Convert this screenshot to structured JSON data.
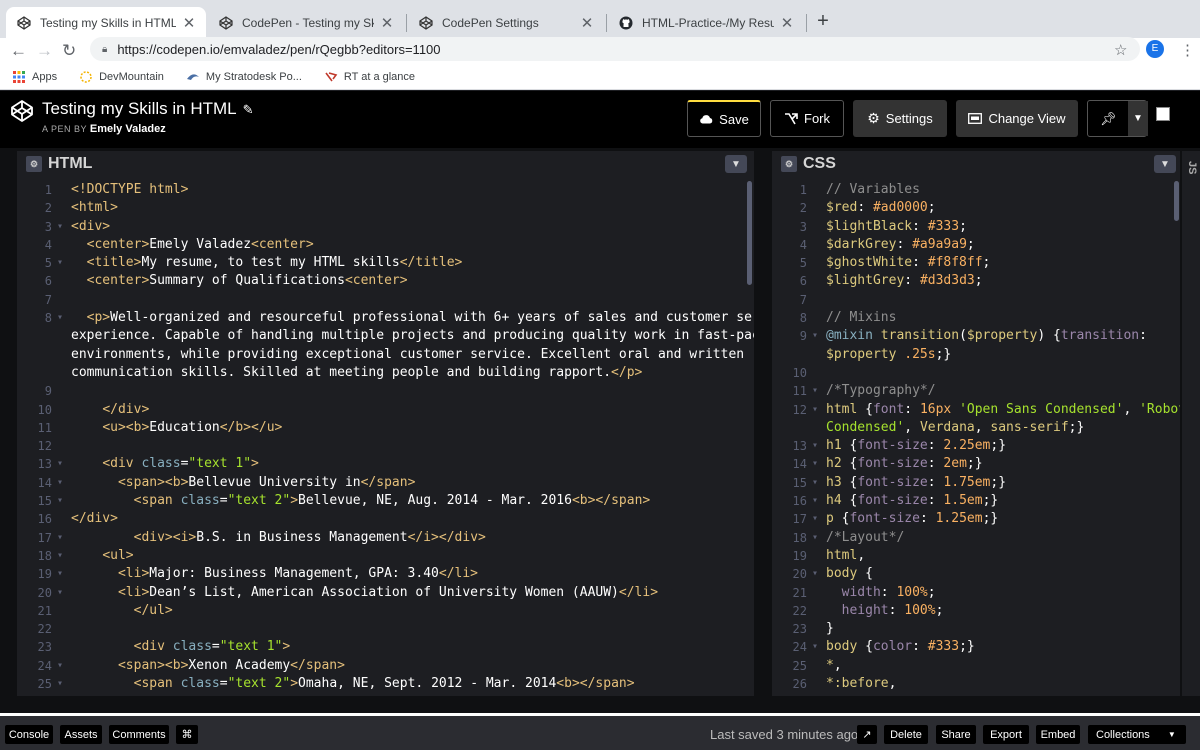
{
  "browser": {
    "tabs": [
      {
        "title": "Testing my Skills in HTML",
        "icon": "codepen-icon"
      },
      {
        "title": "CodePen - Testing my Skills in",
        "icon": "codepen-icon"
      },
      {
        "title": "CodePen Settings",
        "icon": "codepen-icon"
      },
      {
        "title": "HTML-Practice-/My Resume at",
        "icon": "github-icon"
      }
    ],
    "url": "https://codepen.io/emvaladez/pen/rQegbb?editors=1100",
    "profile_initial": "E",
    "bookmarks": [
      {
        "label": "Apps",
        "icon": "apps-grid-icon"
      },
      {
        "label": "DevMountain",
        "icon": "devmountain-icon"
      },
      {
        "label": "My Stratodesk Po...",
        "icon": "stratodesk-icon"
      },
      {
        "label": "RT at a glance",
        "icon": "rt-icon"
      }
    ]
  },
  "pen": {
    "title": "Testing my Skills in HTML",
    "byline_prefix": "A PEN BY",
    "author": "Emely Valadez"
  },
  "toolbar": {
    "save": "Save",
    "fork": "Fork",
    "settings": "Settings",
    "change_view": "Change View"
  },
  "editors": {
    "html_title": "HTML",
    "css_title": "CSS",
    "js_title": "JS"
  },
  "html_lines": [
    {
      "n": "1",
      "fold": "",
      "html": "<span class='tg'>&lt;!DOCTYPE html&gt;</span>"
    },
    {
      "n": "2",
      "fold": "",
      "html": "<span class='tg'>&lt;html&gt;</span>"
    },
    {
      "n": "3",
      "fold": "▾",
      "html": "<span class='tg'>&lt;div&gt;</span>"
    },
    {
      "n": "4",
      "fold": "",
      "html": "  <span class='tg'>&lt;center&gt;</span>Emely Valadez<span class='tg'>&lt;center&gt;</span>"
    },
    {
      "n": "5",
      "fold": "▾",
      "html": "  <span class='tg'>&lt;title&gt;</span>My resume, to test my HTML skills<span class='tg'>&lt;/title&gt;</span>"
    },
    {
      "n": "6",
      "fold": "",
      "html": "  <span class='tg'>&lt;center&gt;</span>Summary of Qualifications<span class='tg'>&lt;center&gt;</span>"
    },
    {
      "n": "7",
      "fold": "",
      "html": ""
    },
    {
      "n": "8",
      "fold": "▾",
      "html": "  <span class='tg'>&lt;p&gt;</span>Well-organized and resourceful professional with 6+ years of sales and customer service"
    },
    {
      "n": "",
      "fold": "",
      "html": "experience. Capable of handling multiple projects and producing quality work in fast-paced"
    },
    {
      "n": "",
      "fold": "",
      "html": "environments, while providing exceptional customer service. Excellent oral and written"
    },
    {
      "n": "",
      "fold": "",
      "html": "communication skills. Skilled at meeting people and building rapport.<span class='tg'>&lt;/p&gt;</span>"
    },
    {
      "n": "9",
      "fold": "",
      "html": ""
    },
    {
      "n": "10",
      "fold": "",
      "html": "    <span class='tg'>&lt;/div&gt;</span>"
    },
    {
      "n": "11",
      "fold": "",
      "html": "    <span class='tg'>&lt;u&gt;&lt;b&gt;</span>Education<span class='tg'>&lt;/b&gt;&lt;/u&gt;</span>"
    },
    {
      "n": "12",
      "fold": "",
      "html": ""
    },
    {
      "n": "13",
      "fold": "▾",
      "html": "    <span class='tg'>&lt;div</span> <span class='at'>class</span>=<span class='str'>\"text 1\"</span><span class='tg'>&gt;</span>"
    },
    {
      "n": "14",
      "fold": "▾",
      "html": "      <span class='tg'>&lt;span&gt;&lt;b&gt;</span>Bellevue University in<span class='tg'>&lt;/span&gt;</span>"
    },
    {
      "n": "15",
      "fold": "▾",
      "html": "        <span class='tg'>&lt;span</span> <span class='at'>class</span>=<span class='str'>\"text 2\"</span><span class='tg'>&gt;</span>Bellevue, NE, Aug. 2014 - Mar. 2016<span class='tg'>&lt;b&gt;&lt;/span&gt;</span>"
    },
    {
      "n": "16",
      "fold": "",
      "html": "<span class='tg'>&lt;/div&gt;</span>"
    },
    {
      "n": "17",
      "fold": "▾",
      "html": "        <span class='tg'>&lt;div&gt;&lt;i&gt;</span>B.S. in Business Management<span class='tg'>&lt;/i&gt;&lt;/div&gt;</span>"
    },
    {
      "n": "18",
      "fold": "▾",
      "html": "    <span class='tg'>&lt;ul&gt;</span>"
    },
    {
      "n": "19",
      "fold": "▾",
      "html": "      <span class='tg'>&lt;li&gt;</span>Major: Business Management, GPA: 3.40<span class='tg'>&lt;/li&gt;</span>"
    },
    {
      "n": "20",
      "fold": "▾",
      "html": "      <span class='tg'>&lt;li&gt;</span>Dean’s List, American Association of University Women (AAUW)<span class='tg'>&lt;/li&gt;</span>"
    },
    {
      "n": "21",
      "fold": "",
      "html": "        <span class='tg'>&lt;/ul&gt;</span>"
    },
    {
      "n": "22",
      "fold": "",
      "html": ""
    },
    {
      "n": "23",
      "fold": "",
      "html": "        <span class='tg'>&lt;div</span> <span class='at'>class</span>=<span class='str'>\"text 1\"</span><span class='tg'>&gt;</span>"
    },
    {
      "n": "24",
      "fold": "▾",
      "html": "      <span class='tg'>&lt;span&gt;&lt;b&gt;</span>Xenon Academy<span class='tg'>&lt;/span&gt;</span>"
    },
    {
      "n": "25",
      "fold": "▾",
      "html": "        <span class='tg'>&lt;span</span> <span class='at'>class</span>=<span class='str'>\"text 2\"</span><span class='tg'>&gt;</span>Omaha, NE, Sept. 2012 - Mar. 2014<span class='tg'>&lt;b&gt;&lt;/span&gt;</span>"
    }
  ],
  "css_lines": [
    {
      "n": "1",
      "fold": "",
      "html": "<span class='cm'>// Variables</span>"
    },
    {
      "n": "2",
      "fold": "",
      "html": "<span class='tb'>$red</span>: <span class='val'>#ad0000</span>;"
    },
    {
      "n": "3",
      "fold": "",
      "html": "<span class='tb'>$lightBlack</span>: <span class='val'>#333</span>;"
    },
    {
      "n": "4",
      "fold": "",
      "html": "<span class='tb'>$darkGrey</span>: <span class='val'>#a9a9a9</span>;"
    },
    {
      "n": "5",
      "fold": "",
      "html": "<span class='tb'>$ghostWhite</span>: <span class='val'>#f8f8ff</span>;"
    },
    {
      "n": "6",
      "fold": "",
      "html": "<span class='tb'>$lightGrey</span>: <span class='val'>#d3d3d3</span>;"
    },
    {
      "n": "7",
      "fold": "",
      "html": ""
    },
    {
      "n": "8",
      "fold": "",
      "html": "<span class='cm'>// Mixins</span>"
    },
    {
      "n": "9",
      "fold": "▾",
      "html": "<span class='at'>@mixin</span> <span class='tb'>transition</span>(<span class='tb'>$property</span>) {<span class='pr'>transition</span>:"
    },
    {
      "n": "",
      "fold": "",
      "html": "<span class='tb'>$property</span> <span class='val'>.25s</span>;}"
    },
    {
      "n": "10",
      "fold": "",
      "html": ""
    },
    {
      "n": "11",
      "fold": "▾",
      "html": "<span class='cm'>/*Typography*/</span>"
    },
    {
      "n": "12",
      "fold": "▾",
      "html": "<span class='tb'>html</span> {<span class='pr'>font</span>: <span class='val'>16px</span> <span class='st'>'Open Sans Condensed'</span>, <span class='st'>'Roboto</span>"
    },
    {
      "n": "",
      "fold": "",
      "html": "<span class='st'>Condensed'</span>, <span class='tb'>Verdana</span>, <span class='tb'>sans-serif</span>;}"
    },
    {
      "n": "13",
      "fold": "▾",
      "html": "<span class='tb'>h1</span> {<span class='pr'>font-size</span>: <span class='val'>2.25em</span>;}"
    },
    {
      "n": "14",
      "fold": "▾",
      "html": "<span class='tb'>h2</span> {<span class='pr'>font-size</span>: <span class='val'>2em</span>;}"
    },
    {
      "n": "15",
      "fold": "▾",
      "html": "<span class='tb'>h3</span> {<span class='pr'>font-size</span>: <span class='val'>1.75em</span>;}"
    },
    {
      "n": "16",
      "fold": "▾",
      "html": "<span class='tb'>h4</span> {<span class='pr'>font-size</span>: <span class='val'>1.5em</span>;}"
    },
    {
      "n": "17",
      "fold": "▾",
      "html": "<span class='tb'>p</span> {<span class='pr'>font-size</span>: <span class='val'>1.25em</span>;}"
    },
    {
      "n": "18",
      "fold": "▾",
      "html": "<span class='cm'>/*Layout*/</span>"
    },
    {
      "n": "19",
      "fold": "",
      "html": "<span class='tb'>html</span>,"
    },
    {
      "n": "20",
      "fold": "▾",
      "html": "<span class='tb'>body</span> {"
    },
    {
      "n": "21",
      "fold": "",
      "html": "  <span class='pr'>width</span>: <span class='val'>100%</span>;"
    },
    {
      "n": "22",
      "fold": "",
      "html": "  <span class='pr'>height</span>: <span class='val'>100%</span>;"
    },
    {
      "n": "23",
      "fold": "",
      "html": "}"
    },
    {
      "n": "24",
      "fold": "▾",
      "html": "<span class='tb'>body</span> {<span class='pr'>color</span>: <span class='val'>#333</span>;}"
    },
    {
      "n": "25",
      "fold": "",
      "html": "<span class='tb'>*</span>,"
    },
    {
      "n": "26",
      "fold": "",
      "html": "<span class='tb'>*:before</span>,"
    }
  ],
  "footer": {
    "console": "Console",
    "assets": "Assets",
    "comments": "Comments",
    "shortcut": "⌘",
    "last_saved": "Last saved 3 minutes ago",
    "delete": "Delete",
    "share": "Share",
    "export": "Export",
    "embed": "Embed",
    "collections": "Collections"
  },
  "colors": {
    "accent_save": "#ffdd40",
    "editor_bg": "#1d1e22",
    "header_bg": "#000000"
  }
}
